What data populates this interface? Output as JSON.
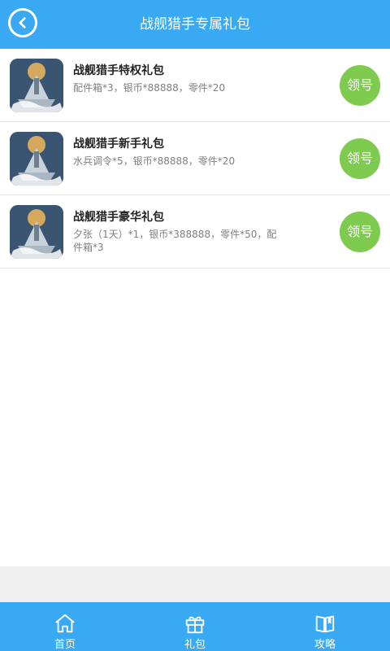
{
  "header": {
    "title": "战舰猎手专属礼包",
    "back_icon": "chevron-left-icon"
  },
  "gifts": [
    {
      "name": "战舰猎手特权礼包",
      "desc": "配件箱*3，银币*88888，零件*20",
      "button": "领号"
    },
    {
      "name": "战舰猎手新手礼包",
      "desc": "水兵调令*5，银币*88888，零件*20",
      "button": "领号"
    },
    {
      "name": "战舰猎手豪华礼包",
      "desc": "夕张（1天）*1，银币*388888，零件*50，配件箱*3",
      "button": "领号"
    }
  ],
  "tabbar": {
    "items": [
      {
        "label": "首页",
        "icon": "home-icon"
      },
      {
        "label": "礼包",
        "icon": "gift-icon"
      },
      {
        "label": "攻略",
        "icon": "book-icon"
      }
    ]
  },
  "colors": {
    "primary": "#3aa9f4",
    "claim_button": "#7ecb4f"
  }
}
